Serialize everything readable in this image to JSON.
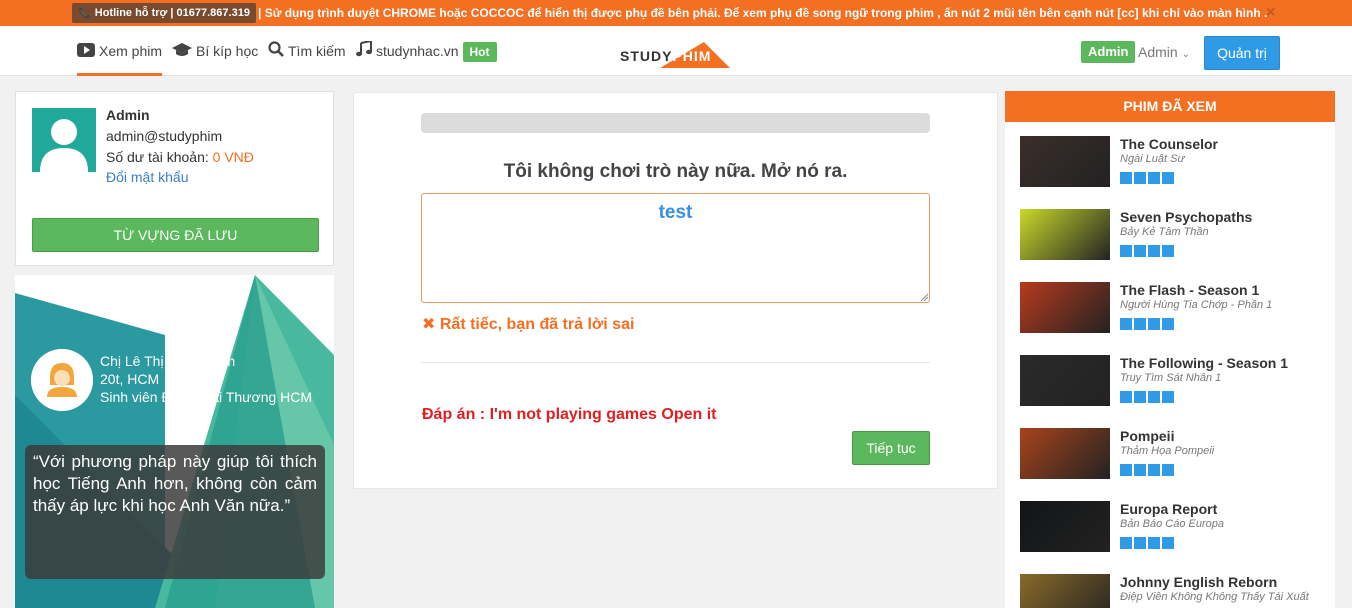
{
  "notice": {
    "hotline": "📞 Hotline hỗ trợ | 01677.867.319",
    "text": "| Sử dụng trình duyệt CHROME hoặc COCCOC để hiển thị được phụ đề bên phải. Để xem phụ đề song ngữ trong phim , ấn nút 2 mũi tên bên cạnh nút [cc] khi chỉ vào màn hình .",
    "close": "×"
  },
  "nav": {
    "items": [
      {
        "label": "Xem phim",
        "icon": "play-icon"
      },
      {
        "label": "Bí kíp học",
        "icon": "graduation-cap-icon"
      },
      {
        "label": "Tìm kiếm",
        "icon": "search-icon"
      },
      {
        "label": "studynhac.vn",
        "icon": "music-icon",
        "badge": "Hot"
      }
    ],
    "logo": {
      "left": "STUDY",
      "right": "PHIM"
    },
    "admin_badge": "Admin",
    "admin_name": "Admin",
    "admin_button": "Quản trị"
  },
  "profile": {
    "name": "Admin",
    "email": "admin@studyphim",
    "balance_label": "Số dư tài khoản:",
    "balance_value": "0 VNĐ",
    "change_password": "Đổi mật khẩu",
    "vocab_button": "TỪ VỰNG ĐÃ LƯU"
  },
  "testimonial": {
    "name": "Chị Lê Thị Ngọc Loan",
    "age_city": "20t, HCM",
    "school": "Sinh viên ĐH Ngoại Thương HCM",
    "quote": "“Với phương pháp này giúp tôi thích học Tiếng Anh hơn, không còn cảm thấy áp lực khi học Anh Văn nữa.”"
  },
  "quiz": {
    "prompt": "Tôi không chơi trò này nữa. Mở nó ra.",
    "answer_value": "test",
    "wrong_message": "Rất tiếc, bạn đã trả lời sai",
    "correct_answer": "Đáp án : I'm not playing games Open it",
    "next_button": "Tiếp tục"
  },
  "watched": {
    "title": "PHIM ĐÃ XEM",
    "movies": [
      {
        "title": "The Counselor",
        "subtitle": "Ngài Luật Sư",
        "rating": 4,
        "thumb_color": "#3a2e2a"
      },
      {
        "title": "Seven Psychopaths",
        "subtitle": "Bảy Kẻ Tâm Thần",
        "rating": 4,
        "thumb_color": "#c9d92a"
      },
      {
        "title": "The Flash - Season 1",
        "subtitle": "Người Hùng Tia Chớp - Phần 1",
        "rating": 4,
        "thumb_color": "#b83a1e"
      },
      {
        "title": "The Following - Season 1",
        "subtitle": "Truy Tìm Sát Nhân 1",
        "rating": 4,
        "thumb_color": "#2a2a2a"
      },
      {
        "title": "Pompeii",
        "subtitle": "Thảm Họa Pompeii",
        "rating": 4,
        "thumb_color": "#a8441c"
      },
      {
        "title": "Europa Report",
        "subtitle": "Bản Báo Cáo Europa",
        "rating": 4,
        "thumb_color": "#121416"
      },
      {
        "title": "Johnny English Reborn",
        "subtitle": "Điệp Viên Không Không Thấy Tái Xuất",
        "rating": 4,
        "thumb_color": "#8a6a2a"
      }
    ]
  },
  "colors": {
    "accent": "#f36f21",
    "green": "#5cb85c",
    "blue": "#2f9be6",
    "teal": "#20a89a"
  }
}
